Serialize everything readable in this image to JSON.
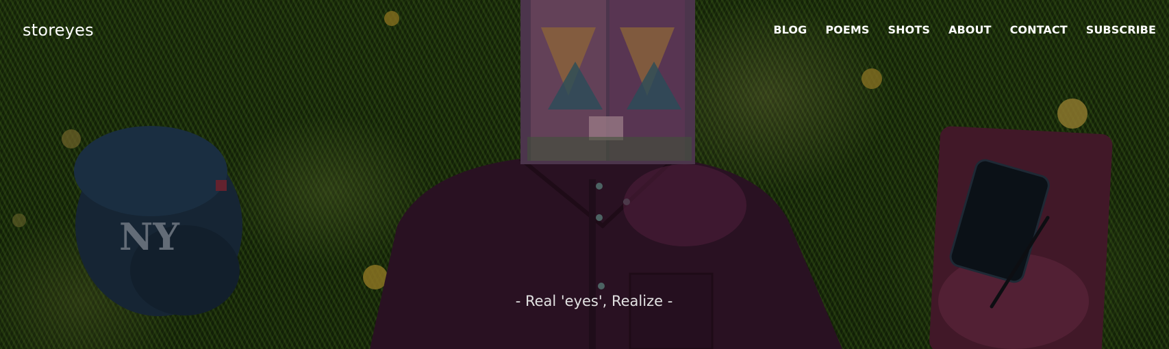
{
  "site": {
    "title": "storeyes"
  },
  "nav": {
    "items": [
      {
        "label": "BLOG"
      },
      {
        "label": "POEMS"
      },
      {
        "label": "SHOTS"
      },
      {
        "label": "ABOUT"
      },
      {
        "label": "CONTACT"
      },
      {
        "label": "SUBSCRIBE"
      }
    ]
  },
  "hero": {
    "tagline": "- Real 'eyes', Realize -",
    "image": {
      "subject": "person lying on grass with a book covering face, cap, phone, notebook and pen",
      "colors": {
        "grass": "#2a4412",
        "shirt": "#3a1830",
        "cap": "#1f3448",
        "notebook": "#5a2238",
        "book": "#8a5a7a"
      }
    }
  }
}
